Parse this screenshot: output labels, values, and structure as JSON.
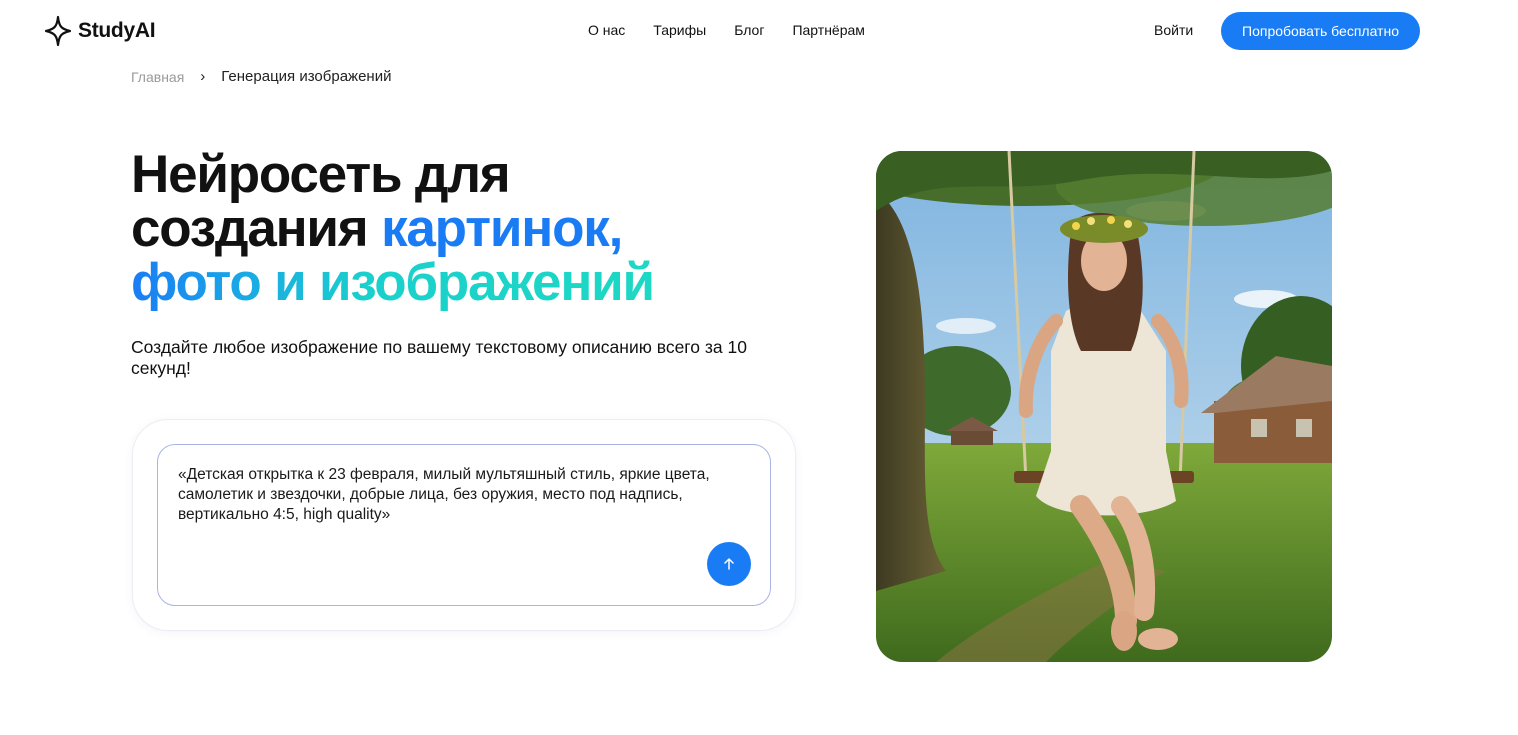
{
  "header": {
    "brand": "StudyAI",
    "nav": [
      "О нас",
      "Тарифы",
      "Блог",
      "Партнёрам"
    ],
    "login": "Войти",
    "cta": "Попробовать бесплатно"
  },
  "breadcrumb": {
    "home": "Главная",
    "separator": "›",
    "current": "Генерация изображений"
  },
  "hero": {
    "title_part1": "Нейросеть для",
    "title_part2": "создания ",
    "title_highlight1": "картинок,",
    "title_highlight2": "фото и изображений",
    "subtitle": "Создайте любое изображение по вашему текстовому описанию всего за 10 секунд!"
  },
  "prompt": {
    "text": "«Детская открытка к 23 февраля, милый мультяшный стиль, яркие цвета, самолетик и звездочки, добрые лица, без оружия, место под надпись, вертикально 4:5, high quality»"
  },
  "colors": {
    "accent": "#1a7cf5",
    "accent_teal": "#1dd8c4"
  },
  "icons": {
    "logo": "sparkle-star-icon",
    "send": "arrow-up-icon"
  }
}
